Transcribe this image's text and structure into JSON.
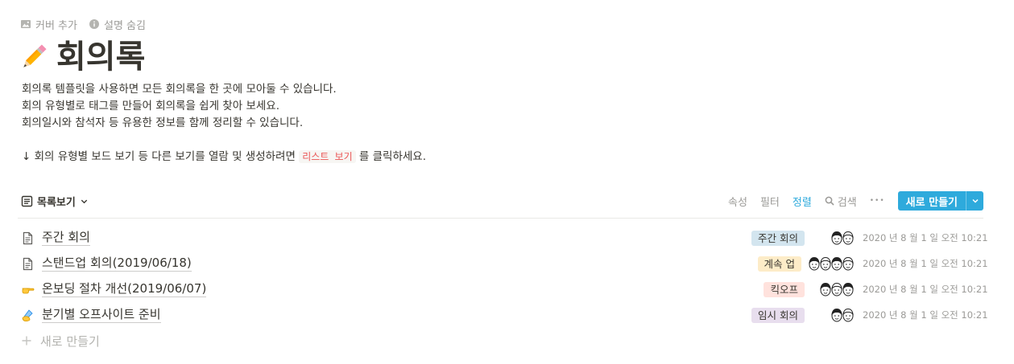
{
  "top_actions": {
    "add_cover": "커버 추가",
    "hide_description": "설명 숨김"
  },
  "page": {
    "icon": "pencil-emoji",
    "title": "회의록"
  },
  "description": {
    "line1": "회의록 템플릿을 사용하면 모든 회의록을 한 곳에 모아둘 수 있습니다.",
    "line2": "회의 유형별로 태그를 만들어 회의록을 쉽게 찾아 보세요.",
    "line3": "회의일시와 참석자 등 유용한 정보를 함께 정리할 수 있습니다.",
    "line4_prefix": "↓ 회의 유형별 보드 보기 등 다른 보기를 열람 및 생성하려면 ",
    "line4_code": "리스트 보기",
    "line4_suffix": " 를 클릭하세요."
  },
  "toolbar": {
    "view_label": "목록보기",
    "properties": "속성",
    "filter": "필터",
    "sort": "정렬",
    "search": "검색",
    "more": "•••",
    "new_button": "새로 만들기"
  },
  "rows": [
    {
      "icon": "document-icon",
      "title": "주간 회의",
      "tag": "주간 회의",
      "tag_color": "#d3e5ef",
      "avatars": 2,
      "date": "2020 년 8 월 1 일 오전 10:21"
    },
    {
      "icon": "document-icon",
      "title": "스탠드업 회의(2019/06/18)",
      "tag": "계속 업",
      "tag_color": "#fdecc8",
      "avatars": 4,
      "date": "2020 년 8 월 1 일 오전 10:21"
    },
    {
      "icon": "pointing-hand-emoji",
      "title": "온보딩 절차 개선(2019/06/07)",
      "tag": "킥오프",
      "tag_color": "#ffe2dd",
      "avatars": 3,
      "date": "2020 년 8 월 1 일 오전 10:21"
    },
    {
      "icon": "writing-hand-emoji",
      "title": "분기별 오프사이트 준비",
      "tag": "임시 회의",
      "tag_color": "#e8deee",
      "avatars": 2,
      "date": "2020 년 8 월 1 일 오전 10:21"
    }
  ],
  "new_row_label": "새로 만들기",
  "colors": {
    "accent": "#2eaadc",
    "text": "#37352f",
    "muted": "#9b9a97"
  }
}
